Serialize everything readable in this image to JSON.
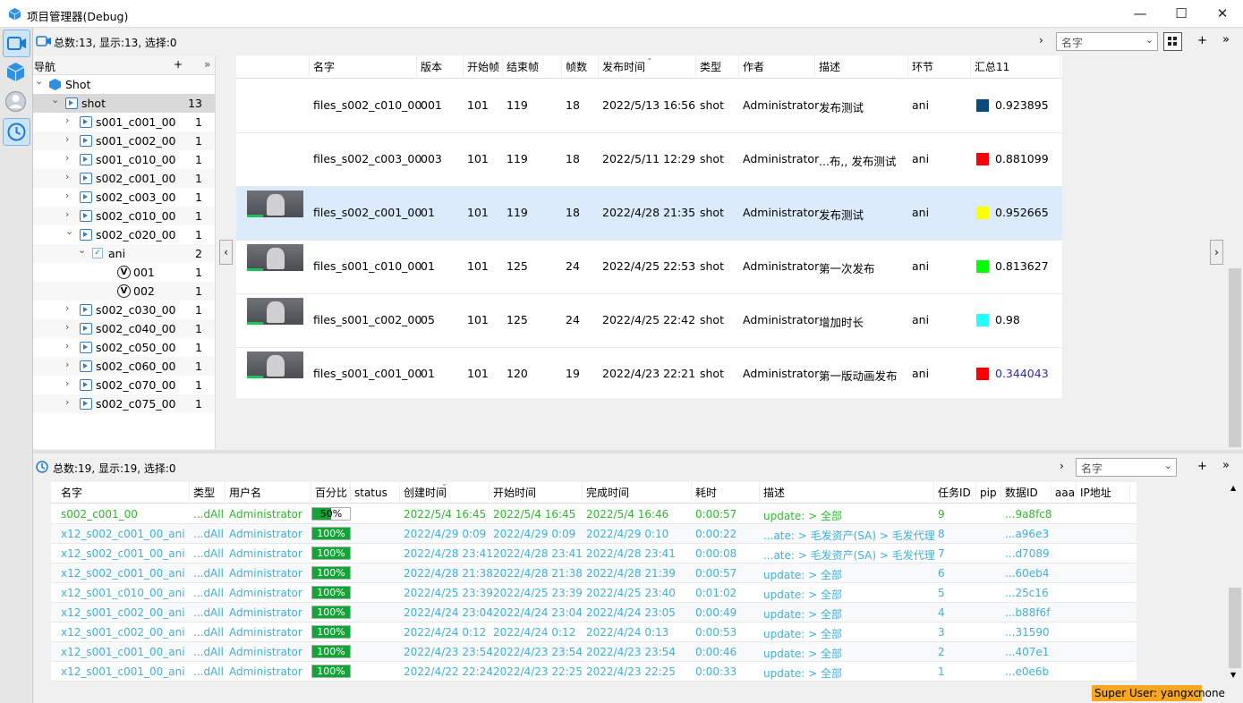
{
  "window": {
    "title": "项目管理器(Debug)",
    "minimize": "—",
    "maximize": "☐",
    "close": "✕"
  },
  "top_bar": {
    "counts": "总数:13, 显示:13, 选择:0",
    "search_field": "名字",
    "add_label": "+",
    "more_label": "»"
  },
  "bottom_bar": {
    "counts": "总数:19, 显示:19, 选择:0",
    "search_field": "名字",
    "add_label": "+",
    "more_label": "»"
  },
  "nav": {
    "header": "导航",
    "add": "+",
    "collapse": "»",
    "tree": [
      {
        "label": "Shot",
        "count": "",
        "depth": 0,
        "expanded": true,
        "icon": "cube-icon"
      },
      {
        "label": "shot",
        "count": "13",
        "depth": 1,
        "expanded": true,
        "icon": "folder-icon",
        "selected": true
      },
      {
        "label": "s001_c001_00",
        "count": "1",
        "depth": 2,
        "expanded": false,
        "icon": "shot-icon"
      },
      {
        "label": "s001_c002_00",
        "count": "1",
        "depth": 2,
        "expanded": false,
        "icon": "shot-icon"
      },
      {
        "label": "s001_c010_00",
        "count": "1",
        "depth": 2,
        "expanded": false,
        "icon": "shot-icon"
      },
      {
        "label": "s002_c001_00",
        "count": "1",
        "depth": 2,
        "expanded": false,
        "icon": "shot-icon"
      },
      {
        "label": "s002_c003_00",
        "count": "1",
        "depth": 2,
        "expanded": false,
        "icon": "shot-icon"
      },
      {
        "label": "s002_c010_00",
        "count": "1",
        "depth": 2,
        "expanded": false,
        "icon": "shot-icon"
      },
      {
        "label": "s002_c020_00",
        "count": "1",
        "depth": 2,
        "expanded": true,
        "icon": "shot-icon"
      },
      {
        "label": "ani",
        "count": "2",
        "depth": 3,
        "expanded": true,
        "icon": "checkbox-icon"
      },
      {
        "label": "001",
        "count": "1",
        "depth": 4,
        "expanded": null,
        "icon": "version-icon"
      },
      {
        "label": "002",
        "count": "1",
        "depth": 4,
        "expanded": null,
        "icon": "version-icon"
      },
      {
        "label": "s002_c030_00",
        "count": "1",
        "depth": 2,
        "expanded": false,
        "icon": "shot-icon"
      },
      {
        "label": "s002_c040_00",
        "count": "1",
        "depth": 2,
        "expanded": false,
        "icon": "shot-icon"
      },
      {
        "label": "s002_c050_00",
        "count": "1",
        "depth": 2,
        "expanded": false,
        "icon": "shot-icon"
      },
      {
        "label": "s002_c060_00",
        "count": "1",
        "depth": 2,
        "expanded": false,
        "icon": "shot-icon"
      },
      {
        "label": "s002_c070_00",
        "count": "1",
        "depth": 2,
        "expanded": false,
        "icon": "shot-icon"
      },
      {
        "label": "s002_c075_00",
        "count": "1",
        "depth": 2,
        "expanded": false,
        "icon": "shot-icon"
      }
    ]
  },
  "versions": {
    "headers": [
      "名字",
      "版本",
      "开始帧",
      "结束帧",
      "帧数",
      "发布时间",
      "类型",
      "作者",
      "描述",
      "环节",
      "汇总11"
    ],
    "rows": [
      {
        "thumb": false,
        "name": "files_s002_c010_00",
        "ver": "001",
        "start": "101",
        "end": "119",
        "frames": "18",
        "time": "2022/5/13 16:56",
        "type": "shot",
        "author": "Administrator",
        "desc": "发布测试",
        "step": "ani",
        "color": "#0b4b7a",
        "summary": "0.923895",
        "selected": false
      },
      {
        "thumb": false,
        "name": "files_s002_c003_00",
        "ver": "003",
        "start": "101",
        "end": "119",
        "frames": "18",
        "time": "2022/5/11 12:29",
        "type": "shot",
        "author": "Administrator",
        "desc": "...布,, 发布测试",
        "step": "ani",
        "color": "#ff0000",
        "summary": "0.881099",
        "selected": false
      },
      {
        "thumb": true,
        "name": "files_s002_c001_00",
        "ver": "01",
        "start": "101",
        "end": "119",
        "frames": "18",
        "time": "2022/4/28 21:35",
        "type": "shot",
        "author": "Administrator",
        "desc": "发布测试",
        "step": "ani",
        "color": "#ffff00",
        "summary": "0.952665",
        "selected": true
      },
      {
        "thumb": true,
        "name": "files_s001_c010_00",
        "ver": "01",
        "start": "101",
        "end": "125",
        "frames": "24",
        "time": "2022/4/25 22:53",
        "type": "shot",
        "author": "Administrator",
        "desc": "第一次发布",
        "step": "ani",
        "color": "#00ff00",
        "summary": "0.813627",
        "selected": false
      },
      {
        "thumb": true,
        "name": "files_s001_c002_00",
        "ver": "05",
        "start": "101",
        "end": "125",
        "frames": "24",
        "time": "2022/4/25 22:42",
        "type": "shot",
        "author": "Administrator",
        "desc": "增加时长",
        "step": "ani",
        "color": "#22ffff",
        "summary": "0.98",
        "selected": false
      },
      {
        "thumb": true,
        "name": "files_s001_c001_00",
        "ver": "01",
        "start": "101",
        "end": "120",
        "frames": "19",
        "time": "2022/4/23 22:21",
        "type": "shot",
        "author": "Administrator",
        "desc": "第一版动画发布",
        "step": "ani",
        "color": "#ff0000",
        "summary": "0.344043",
        "selected": false
      }
    ]
  },
  "tasks": {
    "headers": [
      "名字",
      "类型",
      "用户名",
      "百分比",
      "status",
      "创建时间",
      "开始时间",
      "完成时间",
      "耗时",
      "描述",
      "任务ID",
      "pip",
      "数据ID",
      "aaa",
      "IP地址"
    ],
    "rows": [
      {
        "name": "s002_c001_00",
        "type": "...dAll",
        "user": "Administrator",
        "pct": "50%",
        "pct_value": 0.5,
        "created": "2022/5/4 16:45",
        "start": "2022/5/4 16:45",
        "done": "2022/5/4 16:46",
        "dur": "0:00:57",
        "desc": "update: > 全部",
        "id": "9",
        "data": "...9a8fc8"
      },
      {
        "name": "x12_s002_c001_00_ani",
        "type": "...dAll",
        "user": "Administrator",
        "pct": "100%",
        "pct_value": 1,
        "created": "2022/4/29 0:09",
        "start": "2022/4/29 0:09",
        "done": "2022/4/29 0:10",
        "dur": "0:00:22",
        "desc": "...ate: > 毛发资产(SA) > 毛发代理",
        "id": "8",
        "data": "...a96e3"
      },
      {
        "name": "x12_s002_c001_00_ani",
        "type": "...dAll",
        "user": "Administrator",
        "pct": "100%",
        "pct_value": 1,
        "created": "2022/4/28 23:41",
        "start": "2022/4/28 23:41",
        "done": "2022/4/28 23:41",
        "dur": "0:00:08",
        "desc": "...ate: > 毛发资产(SA) > 毛发代理",
        "id": "7",
        "data": "...d7089"
      },
      {
        "name": "x12_s002_c001_00_ani",
        "type": "...dAll",
        "user": "Administrator",
        "pct": "100%",
        "pct_value": 1,
        "created": "2022/4/28 21:38",
        "start": "2022/4/28 21:38",
        "done": "2022/4/28 21:39",
        "dur": "0:00:57",
        "desc": "update: > 全部",
        "id": "6",
        "data": "...60eb4"
      },
      {
        "name": "x12_s001_c010_00_ani",
        "type": "...dAll",
        "user": "Administrator",
        "pct": "100%",
        "pct_value": 1,
        "created": "2022/4/25 23:39",
        "start": "2022/4/25 23:39",
        "done": "2022/4/25 23:40",
        "dur": "0:01:02",
        "desc": "update: > 全部",
        "id": "5",
        "data": "...25c16"
      },
      {
        "name": "x12_s001_c002_00_ani",
        "type": "...dAll",
        "user": "Administrator",
        "pct": "100%",
        "pct_value": 1,
        "created": "2022/4/24 23:04",
        "start": "2022/4/24 23:04",
        "done": "2022/4/24 23:05",
        "dur": "0:00:49",
        "desc": "update: > 全部",
        "id": "4",
        "data": "...b88f6f"
      },
      {
        "name": "x12_s001_c002_00_ani",
        "type": "...dAll",
        "user": "Administrator",
        "pct": "100%",
        "pct_value": 1,
        "created": "2022/4/24 0:12",
        "start": "2022/4/24 0:12",
        "done": "2022/4/24 0:13",
        "dur": "0:00:53",
        "desc": "update: > 全部",
        "id": "3",
        "data": "...31590"
      },
      {
        "name": "x12_s001_c001_00_ani",
        "type": "...dAll",
        "user": "Administrator",
        "pct": "100%",
        "pct_value": 1,
        "created": "2022/4/23 23:54",
        "start": "2022/4/23 23:54",
        "done": "2022/4/23 23:54",
        "dur": "0:00:46",
        "desc": "update: > 全部",
        "id": "2",
        "data": "...407e1"
      },
      {
        "name": "x12_s001_c001_00_ani",
        "type": "...dAll",
        "user": "Administrator",
        "pct": "100%",
        "pct_value": 1,
        "created": "2022/4/22 22:24",
        "start": "2022/4/23 22:25",
        "done": "2022/4/23 22:25",
        "dur": "0:00:33",
        "desc": "update: > 全部",
        "id": "1",
        "data": "...e0e6b"
      }
    ]
  },
  "status": {
    "user": "Super User: yangxc",
    "mode": "none"
  }
}
